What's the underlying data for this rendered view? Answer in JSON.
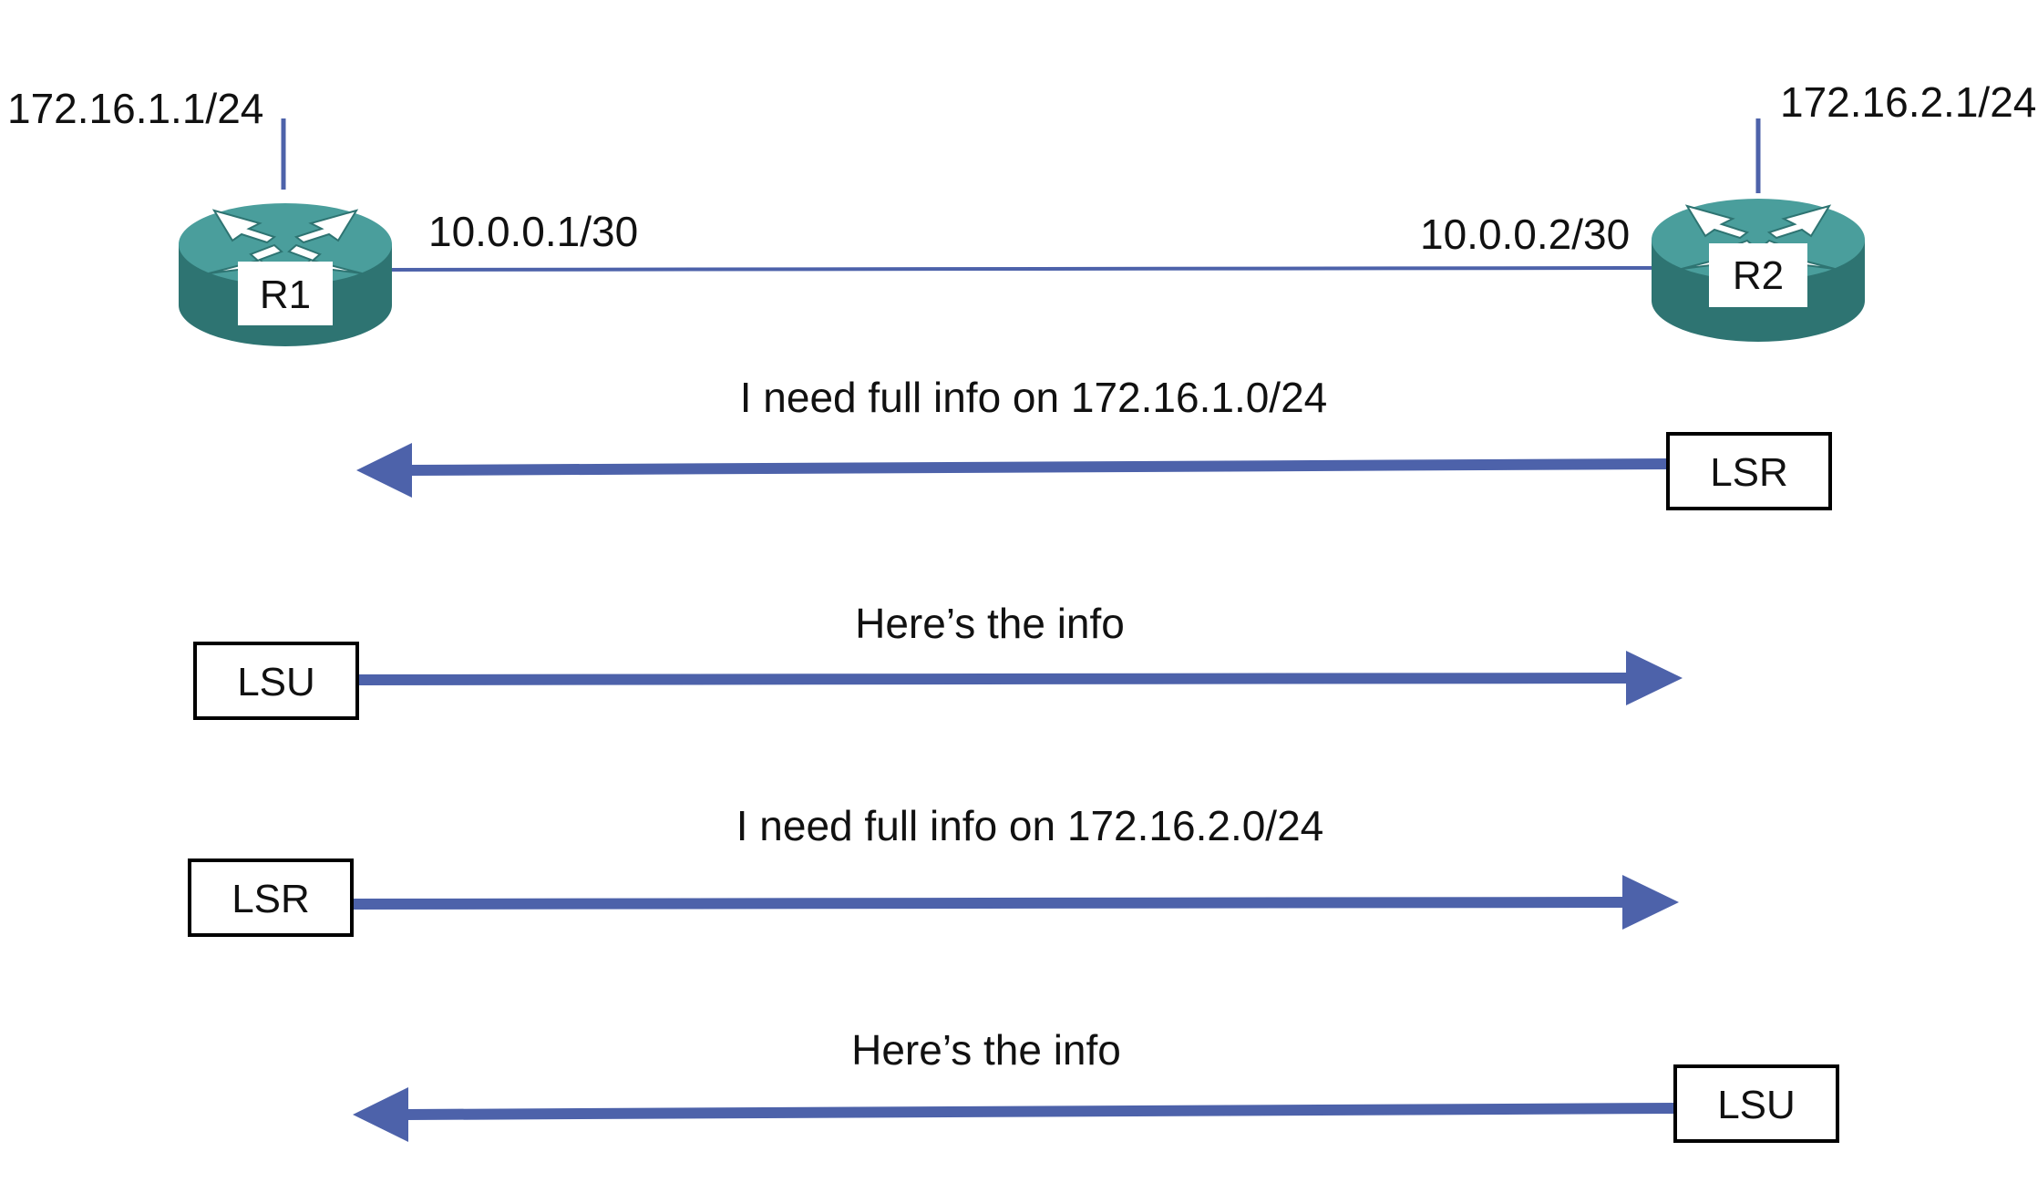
{
  "colors": {
    "link": "#4d62aa",
    "router_top": "#4a9e9c",
    "router_side": "#2e7472",
    "router_label_bg": "#ffffff",
    "text": "#111111",
    "box_border": "#000000"
  },
  "icons": {
    "router": "router-icon",
    "arrow_left": "arrow-left-icon",
    "arrow_right": "arrow-right-icon"
  },
  "routers": {
    "r1": {
      "name": "R1",
      "lan_address": "172.16.1.1/24",
      "link_address": "10.0.0.1/30"
    },
    "r2": {
      "name": "R2",
      "lan_address": "172.16.2.1/24",
      "link_address": "10.0.0.2/30"
    }
  },
  "messages": [
    {
      "text": "I need full info on 172.16.1.0/24",
      "packet": "LSR",
      "direction": "R2 to R1"
    },
    {
      "text": "Here’s the info",
      "packet": "LSU",
      "direction": "R1 to R2"
    },
    {
      "text": "I need full info on 172.16.2.0/24",
      "packet": "LSR",
      "direction": "R1 to R2"
    },
    {
      "text": "Here’s the info",
      "packet": "LSU",
      "direction": "R2 to R1"
    }
  ]
}
